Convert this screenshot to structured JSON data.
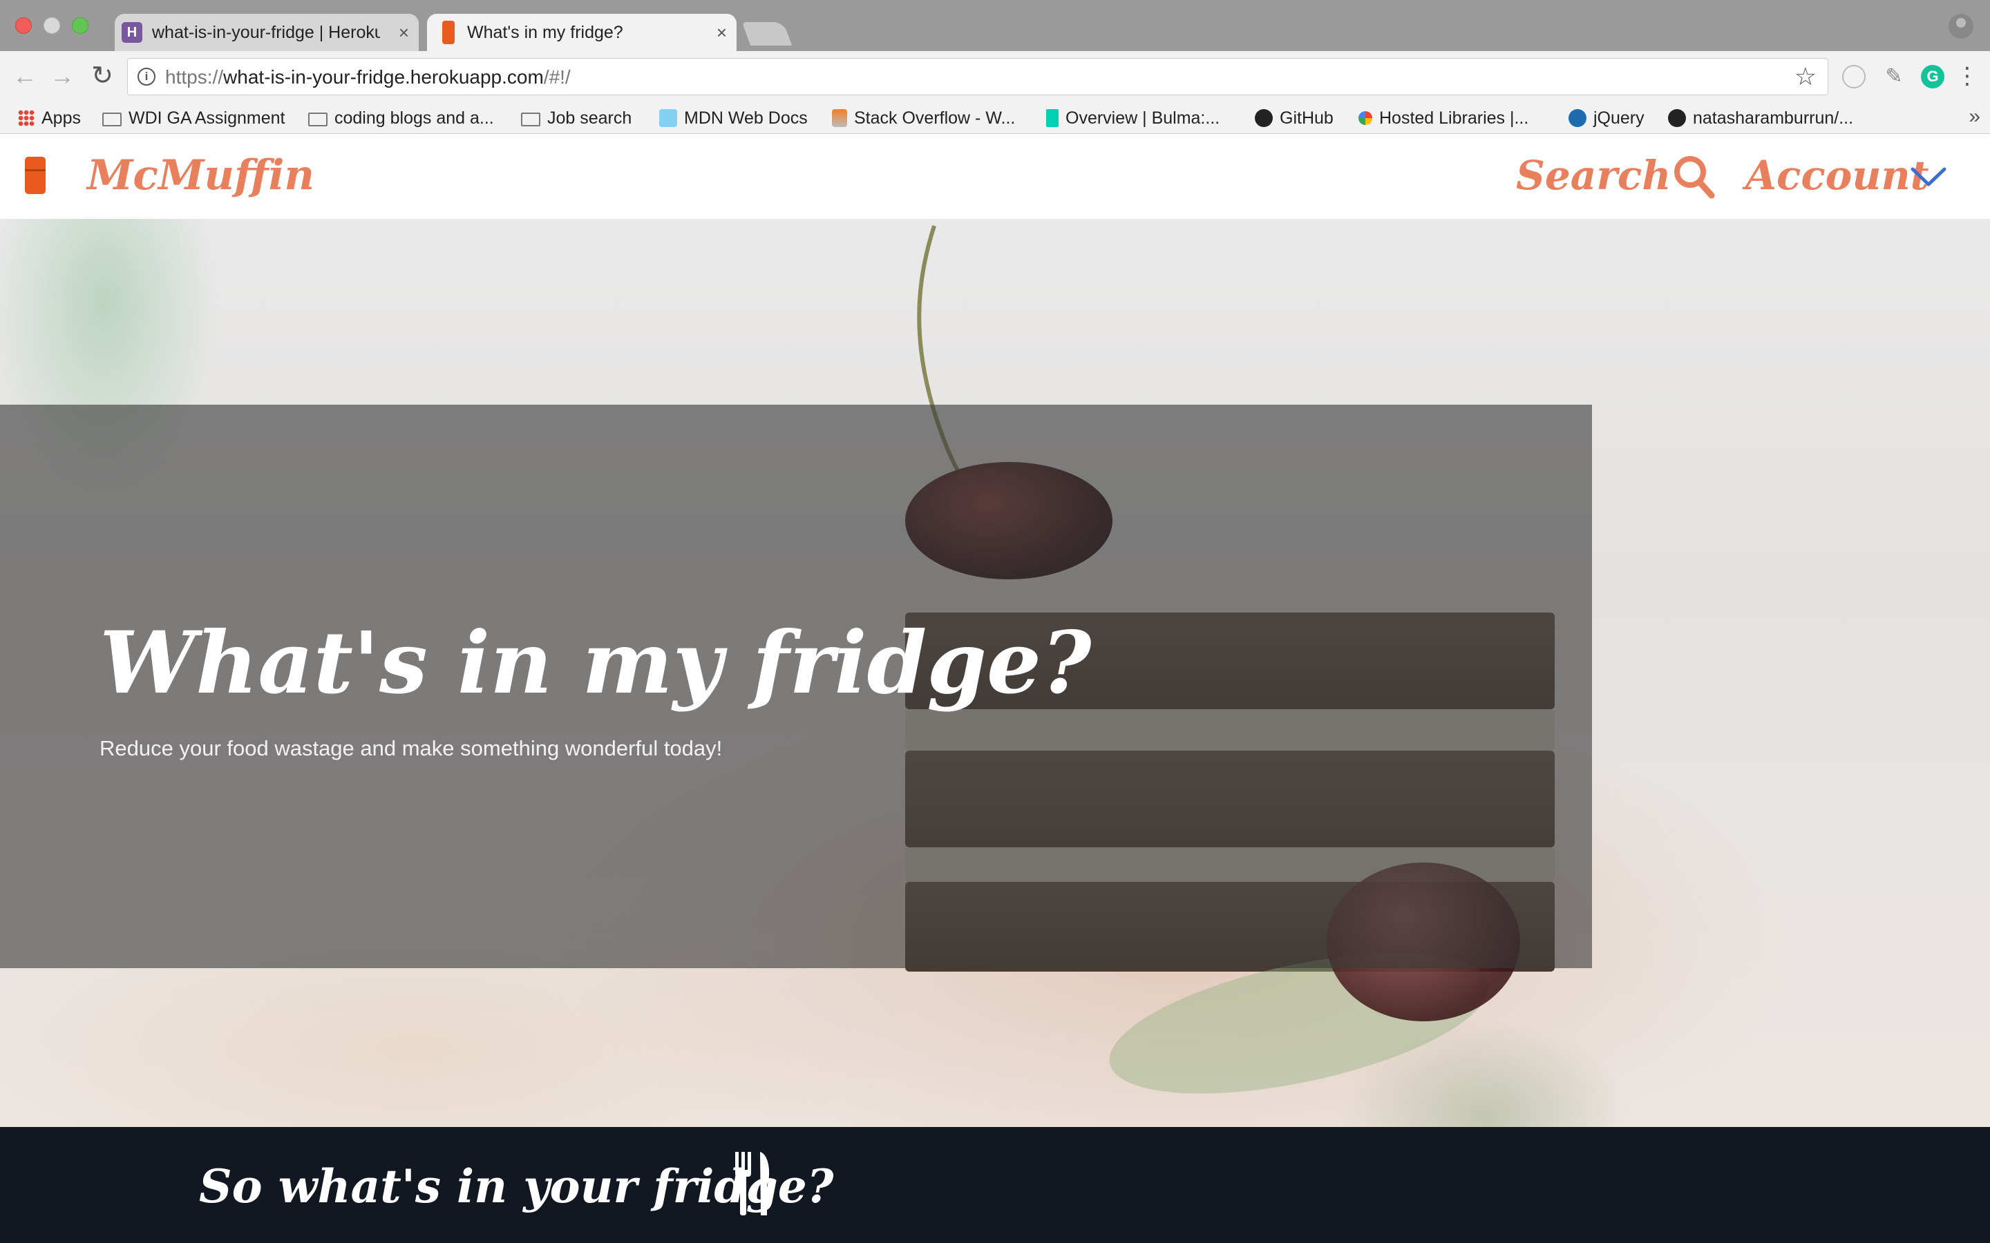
{
  "browser": {
    "tabs": [
      {
        "title": "what-is-in-your-fridge | Heroku",
        "favicon": "heroku-icon",
        "active": false
      },
      {
        "title": "What's in my fridge?",
        "favicon": "fridge-icon",
        "active": true
      }
    ],
    "close_glyph": "×",
    "address": {
      "scheme": "https://",
      "host": "what-is-in-your-fridge.herokuapp.com",
      "path": "/#!/"
    },
    "bookmarks": [
      {
        "label": "Apps",
        "icon": "apps-grid-icon"
      },
      {
        "label": "WDI GA Assignment",
        "icon": "folder-icon"
      },
      {
        "label": "coding blogs and a...",
        "icon": "folder-icon"
      },
      {
        "label": "Job search",
        "icon": "folder-icon"
      },
      {
        "label": "MDN Web Docs",
        "icon": "mdn-icon"
      },
      {
        "label": "Stack Overflow - W...",
        "icon": "stackoverflow-icon"
      },
      {
        "label": "Overview | Bulma:...",
        "icon": "bulma-icon"
      },
      {
        "label": "GitHub",
        "icon": "github-icon"
      },
      {
        "label": "Hosted Libraries  |...",
        "icon": "google-icon"
      },
      {
        "label": "jQuery",
        "icon": "jquery-icon"
      },
      {
        "label": "natasharamburrun/...",
        "icon": "github-icon"
      }
    ],
    "more_glyph": "»"
  },
  "navbar": {
    "brand": "McMuffin",
    "search_label": "Search",
    "account_label": "Account"
  },
  "hero": {
    "title": "What's in my fridge?",
    "subtitle": "Reduce your food wastage and make something wonderful today!"
  },
  "footer": {
    "prompt": "So what's in your fridge?"
  },
  "colors": {
    "brand_accent": "#e8805e",
    "chevron": "#3a6fd0",
    "footer_bg": "#111822",
    "fridge_orange": "#e85a1e"
  }
}
